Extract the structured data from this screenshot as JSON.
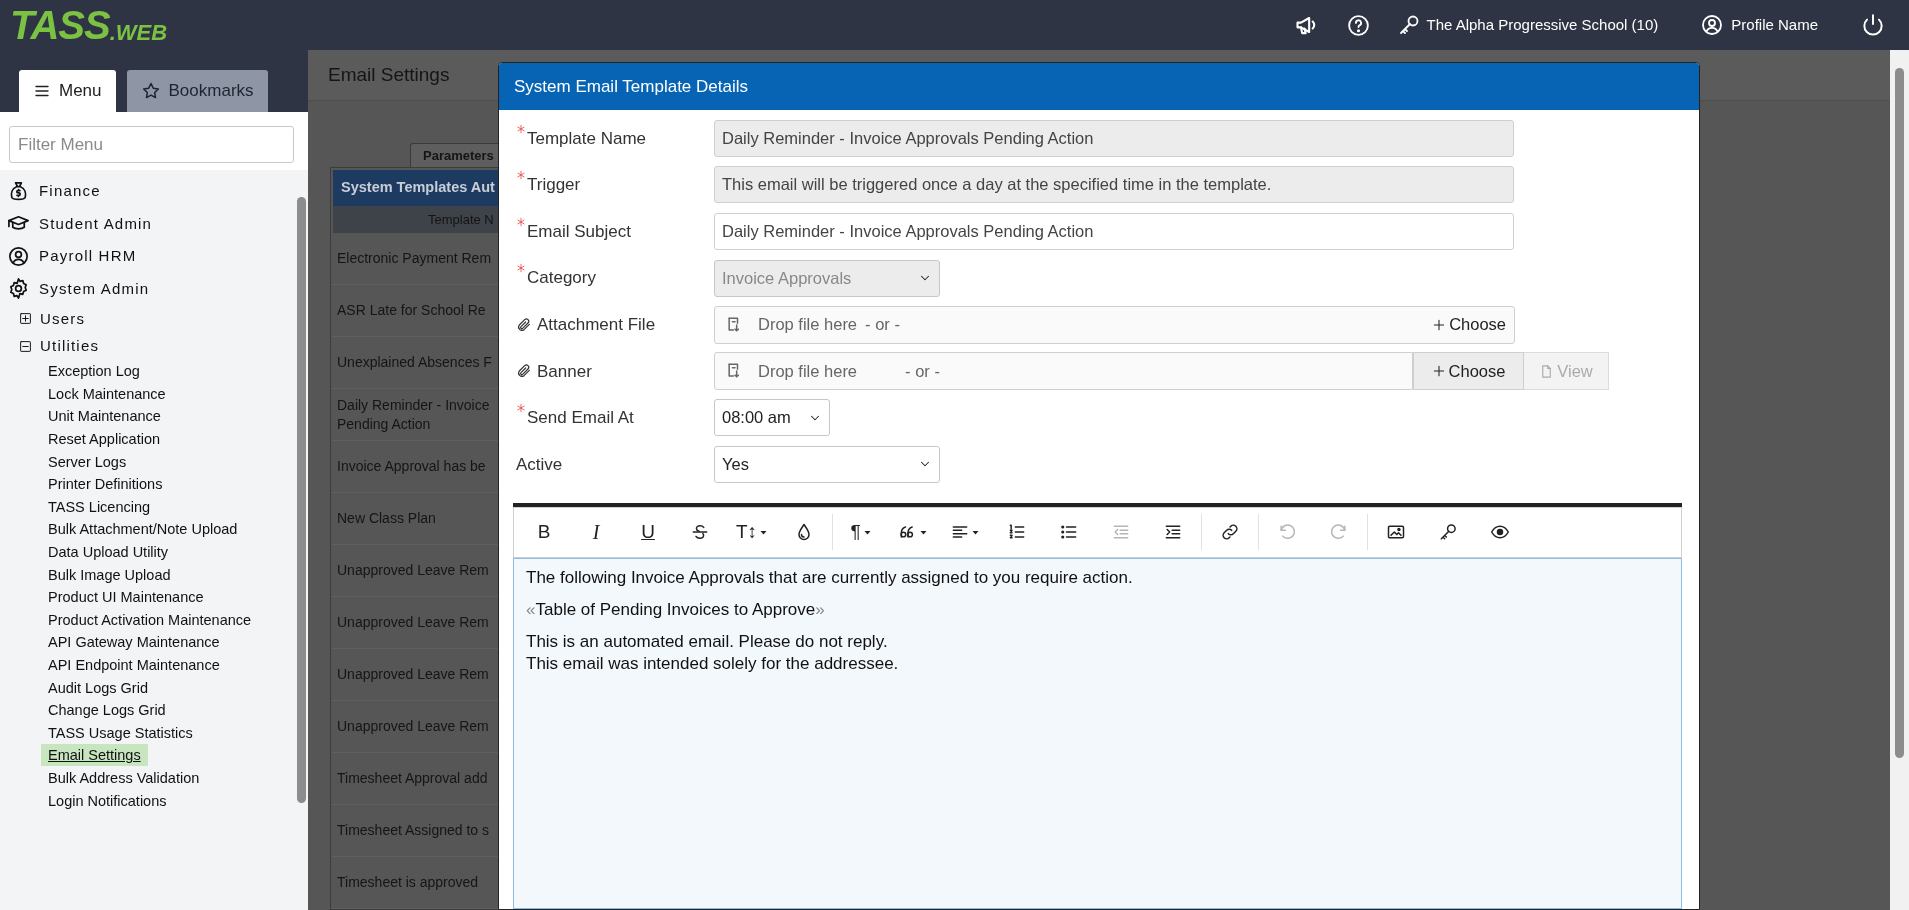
{
  "app": {
    "logo_main": "TASS",
    "logo_suffix": ".WEB"
  },
  "header": {
    "school": "The Alpha Progressive School (10)",
    "profile": "Profile Name"
  },
  "sidebar": {
    "tabs": [
      {
        "label": "Menu",
        "selected": true
      },
      {
        "label": "Bookmarks",
        "selected": false
      }
    ],
    "filter_placeholder": "Filter Menu",
    "modules": [
      {
        "label": "Finance"
      },
      {
        "label": "Student Admin"
      },
      {
        "label": "Payroll HRM"
      },
      {
        "label": "System Admin",
        "children": [
          {
            "label": "Users",
            "expanded": false
          },
          {
            "label": "Utilities",
            "expanded": true,
            "children": [
              {
                "label": "Exception Log",
                "selected": false
              },
              {
                "label": "Lock Maintenance",
                "selected": false
              },
              {
                "label": "Unit Maintenance",
                "selected": false
              },
              {
                "label": "Reset Application",
                "selected": false
              },
              {
                "label": "Server Logs",
                "selected": false
              },
              {
                "label": "Printer Definitions",
                "selected": false
              },
              {
                "label": "TASS Licencing",
                "selected": false
              },
              {
                "label": "Bulk Attachment/Note Upload",
                "selected": false
              },
              {
                "label": "Data Upload Utility",
                "selected": false
              },
              {
                "label": "Bulk Image Upload",
                "selected": false
              },
              {
                "label": "Product UI Maintenance",
                "selected": false
              },
              {
                "label": "Product Activation Maintenance",
                "selected": false
              },
              {
                "label": "API Gateway Maintenance",
                "selected": false
              },
              {
                "label": "API Endpoint Maintenance",
                "selected": false
              },
              {
                "label": "Audit Logs Grid",
                "selected": false
              },
              {
                "label": "Change Logs Grid",
                "selected": false
              },
              {
                "label": "TASS Usage Statistics",
                "selected": false
              },
              {
                "label": "Email Settings",
                "selected": true
              },
              {
                "label": "Bulk Address Validation",
                "selected": false
              },
              {
                "label": "Login Notifications",
                "selected": false
              }
            ]
          }
        ]
      }
    ]
  },
  "page": {
    "title": "Email Settings",
    "tab": "Parameters",
    "table_title": "System Templates Aut",
    "column_1": "Template N",
    "rows": [
      "Electronic Payment Rem",
      "ASR Late for School Re",
      "Unexplained Absences F",
      "Daily Reminder - Invoice\nPending Action",
      "Invoice Approval has be",
      "New Class Plan",
      "Unapproved Leave Rem",
      "Unapproved Leave Rem",
      "Unapproved Leave Rem",
      "Unapproved Leave Rem",
      "Timesheet Approval add",
      "Timesheet Assigned to s",
      "Timesheet is approved"
    ]
  },
  "modal": {
    "title": "System Email Template Details",
    "fields": [
      {
        "label": "Template Name",
        "required": true,
        "kind": "readonly",
        "value": "Daily Reminder - Invoice Approvals Pending Action"
      },
      {
        "label": "Trigger",
        "required": true,
        "kind": "readonly",
        "value": "This email will be triggered once a day at the specified time in the template."
      },
      {
        "label": "Email Subject",
        "required": true,
        "kind": "text",
        "value": "Daily Reminder - Invoice Approvals Pending Action"
      },
      {
        "label": "Category",
        "required": true,
        "kind": "select",
        "value": "Invoice Approvals",
        "disabled": true
      },
      {
        "label": "Attachment File",
        "required": false,
        "kind": "file",
        "drop": "Drop file here",
        "or": "- or -",
        "choose": "Choose"
      },
      {
        "label": "Banner",
        "required": false,
        "kind": "file_view",
        "drop": "Drop file here",
        "or": "- or -",
        "choose": "Choose",
        "view": "View",
        "view_disabled": true
      },
      {
        "label": "Send Email At",
        "required": true,
        "kind": "select",
        "value": "08:00 am",
        "disabled": false
      },
      {
        "label": "Active",
        "required": false,
        "kind": "select",
        "value": "Yes",
        "disabled": false
      }
    ],
    "toolbar": [
      [
        {
          "kind": "glyph",
          "glyph": "B",
          "dropdown": false,
          "disabled": false
        },
        {
          "kind": "glyph",
          "glyph": "I",
          "dropdown": false,
          "disabled": false
        },
        {
          "kind": "glyph",
          "glyph": "U",
          "dropdown": false,
          "disabled": false
        },
        {
          "kind": "icon",
          "dropdown": false,
          "disabled": false
        },
        {
          "kind": "glyph",
          "glyph": "T↕",
          "dropdown": true,
          "disabled": false
        },
        {
          "kind": "icon",
          "dropdown": false,
          "disabled": false
        }
      ],
      [
        {
          "kind": "glyph",
          "glyph": "¶",
          "dropdown": true,
          "disabled": false
        },
        {
          "kind": "icon",
          "dropdown": true,
          "disabled": false
        },
        {
          "kind": "icon",
          "dropdown": true,
          "disabled": false
        },
        {
          "kind": "icon",
          "dropdown": false,
          "disabled": false
        },
        {
          "kind": "icon",
          "dropdown": false,
          "disabled": false
        },
        {
          "kind": "icon",
          "dropdown": false,
          "disabled": true
        },
        {
          "kind": "icon",
          "dropdown": false,
          "disabled": false
        }
      ],
      [
        {
          "kind": "icon",
          "dropdown": false,
          "disabled": false
        }
      ],
      [
        {
          "kind": "icon",
          "dropdown": false,
          "disabled": true
        },
        {
          "kind": "icon",
          "dropdown": false,
          "disabled": true
        }
      ],
      [
        {
          "kind": "icon",
          "dropdown": false,
          "disabled": false
        },
        {
          "kind": "icon",
          "dropdown": false,
          "disabled": false
        },
        {
          "kind": "icon",
          "dropdown": false,
          "disabled": false
        }
      ]
    ],
    "content": [
      {
        "kind": "paragraph",
        "lines": [
          "The following Invoice Approvals that are currently assigned to you require action."
        ]
      },
      {
        "kind": "merge_field",
        "open": "«",
        "text": "Table of Pending Invoices to Approve",
        "close": "»"
      },
      {
        "kind": "paragraph",
        "lines": [
          "This is an automated email. Please do not reply.",
          "This email was intended solely for the addressee."
        ]
      }
    ]
  }
}
